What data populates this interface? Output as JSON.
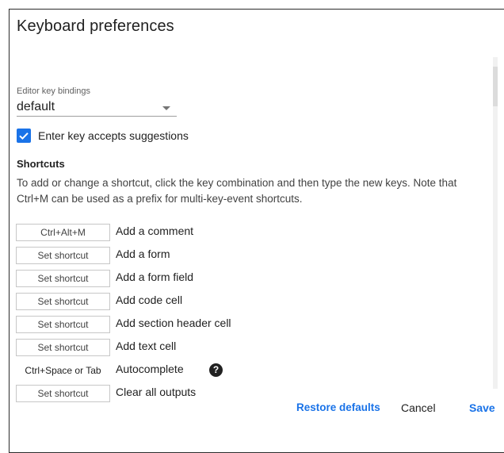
{
  "dialog": {
    "title": "Keyboard preferences"
  },
  "key_bindings": {
    "label": "Editor key bindings",
    "selected": "default"
  },
  "enter_suggestions": {
    "label": "Enter key accepts suggestions",
    "checked": true
  },
  "shortcuts": {
    "heading": "Shortcuts",
    "description": "To add or change a shortcut, click the key combination and then type the new keys. Note that Ctrl+M can be used as a prefix for multi-key-event shortcuts.",
    "rows": [
      {
        "key": "Ctrl+Alt+M",
        "action": "Add a comment"
      },
      {
        "key": "Set shortcut",
        "action": "Add a form"
      },
      {
        "key": "Set shortcut",
        "action": "Add a form field"
      },
      {
        "key": "Set shortcut",
        "action": "Add code cell"
      },
      {
        "key": "Set shortcut",
        "action": "Add section header cell"
      },
      {
        "key": "Set shortcut",
        "action": "Add text cell"
      },
      {
        "key": "Ctrl+Space or Tab",
        "action": "Autocomplete",
        "help": "?"
      },
      {
        "key": "Set shortcut",
        "action": "Clear all outputs"
      }
    ]
  },
  "footer": {
    "restore_label": "Restore defaults",
    "cancel_label": "Cancel",
    "save_label": "Save"
  },
  "colors": {
    "accent": "#1a73e8",
    "text": "#212121",
    "border": "#c7c7c7"
  }
}
